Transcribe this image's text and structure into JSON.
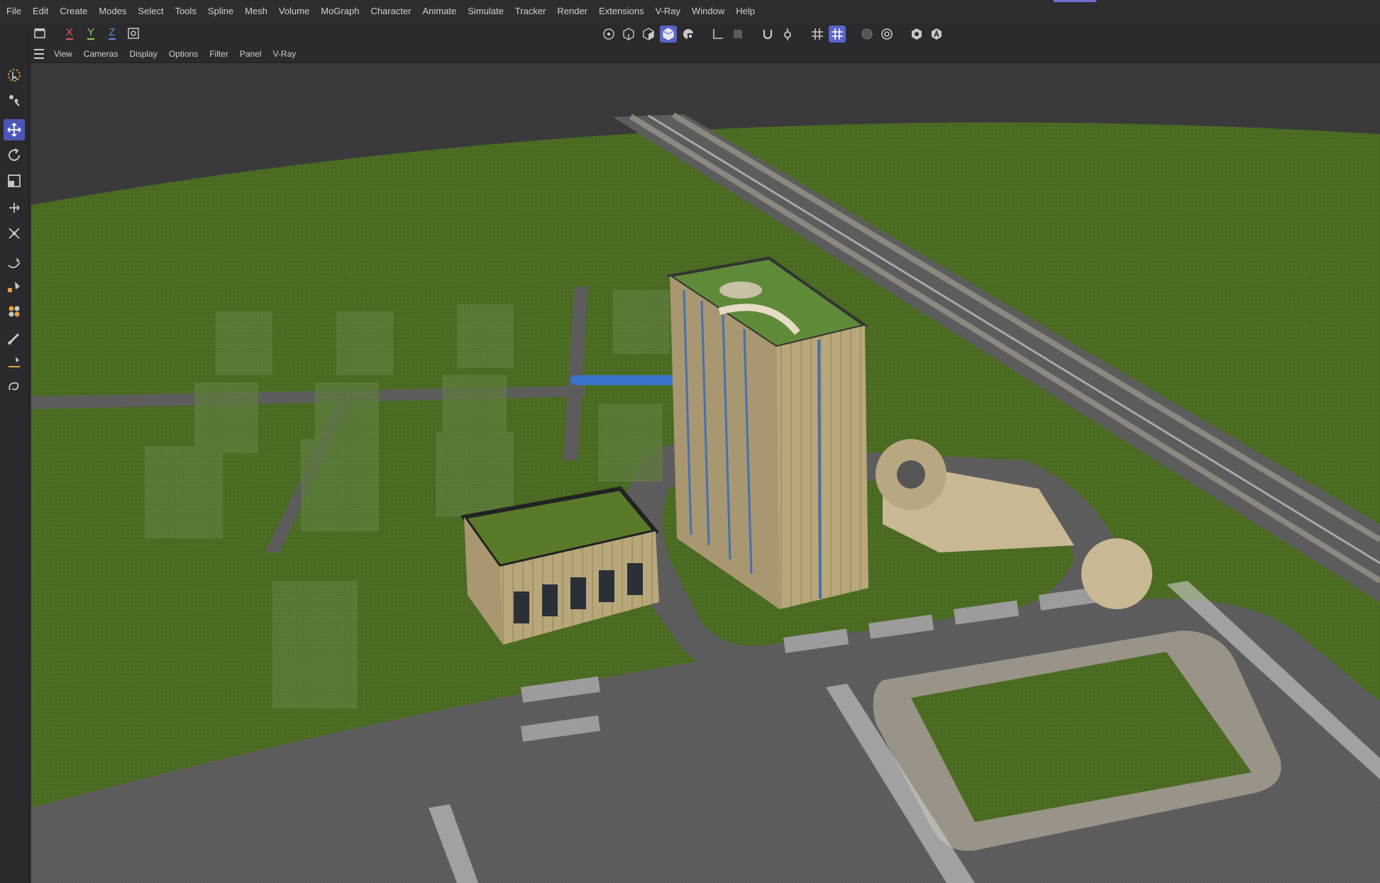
{
  "menu": {
    "items": [
      "File",
      "Edit",
      "Create",
      "Modes",
      "Select",
      "Tools",
      "Spline",
      "Mesh",
      "Volume",
      "MoGraph",
      "Character",
      "Animate",
      "Simulate",
      "Tracker",
      "Render",
      "Extensions",
      "V-Ray",
      "Window",
      "Help"
    ]
  },
  "axis_toolbar": {
    "x_label": "X",
    "y_label": "Y",
    "z_label": "Z"
  },
  "viewport_menu": {
    "items": [
      "View",
      "Cameras",
      "Display",
      "Options",
      "Filter",
      "Panel",
      "V-Ray"
    ]
  },
  "colors": {
    "accent": "#5a64c8",
    "grass": "#4a6a22",
    "road": "#5c5c5c",
    "sidewalk": "#9a9488",
    "building": "#b8a77a",
    "background": "#3a3a3c",
    "x_axis": "#e05a5a",
    "y_axis": "#8fd05a",
    "z_axis": "#5a8fe0"
  },
  "icons": {
    "left_tools": [
      "live-selection-icon",
      "scale-select-icon",
      "move-icon",
      "rotate-icon",
      "scale-icon",
      "move-axis-icon",
      "transform-icon",
      "spline-pen-icon",
      "paint-icon",
      "sculpt-icon",
      "brush-icon",
      "knife-icon",
      "lasso-icon"
    ],
    "center_tools": [
      "points-mode-icon",
      "edges-mode-icon",
      "polygons-mode-icon",
      "model-mode-icon",
      "texture-mode-icon",
      "axis-mode-icon",
      "workplane-icon",
      "snap-magnet-icon",
      "snap-settings-icon",
      "grid-icon",
      "grid-snap-icon",
      "render-view-icon",
      "render-settings-icon",
      "viewport-solo-icon",
      "vray-icon"
    ]
  }
}
